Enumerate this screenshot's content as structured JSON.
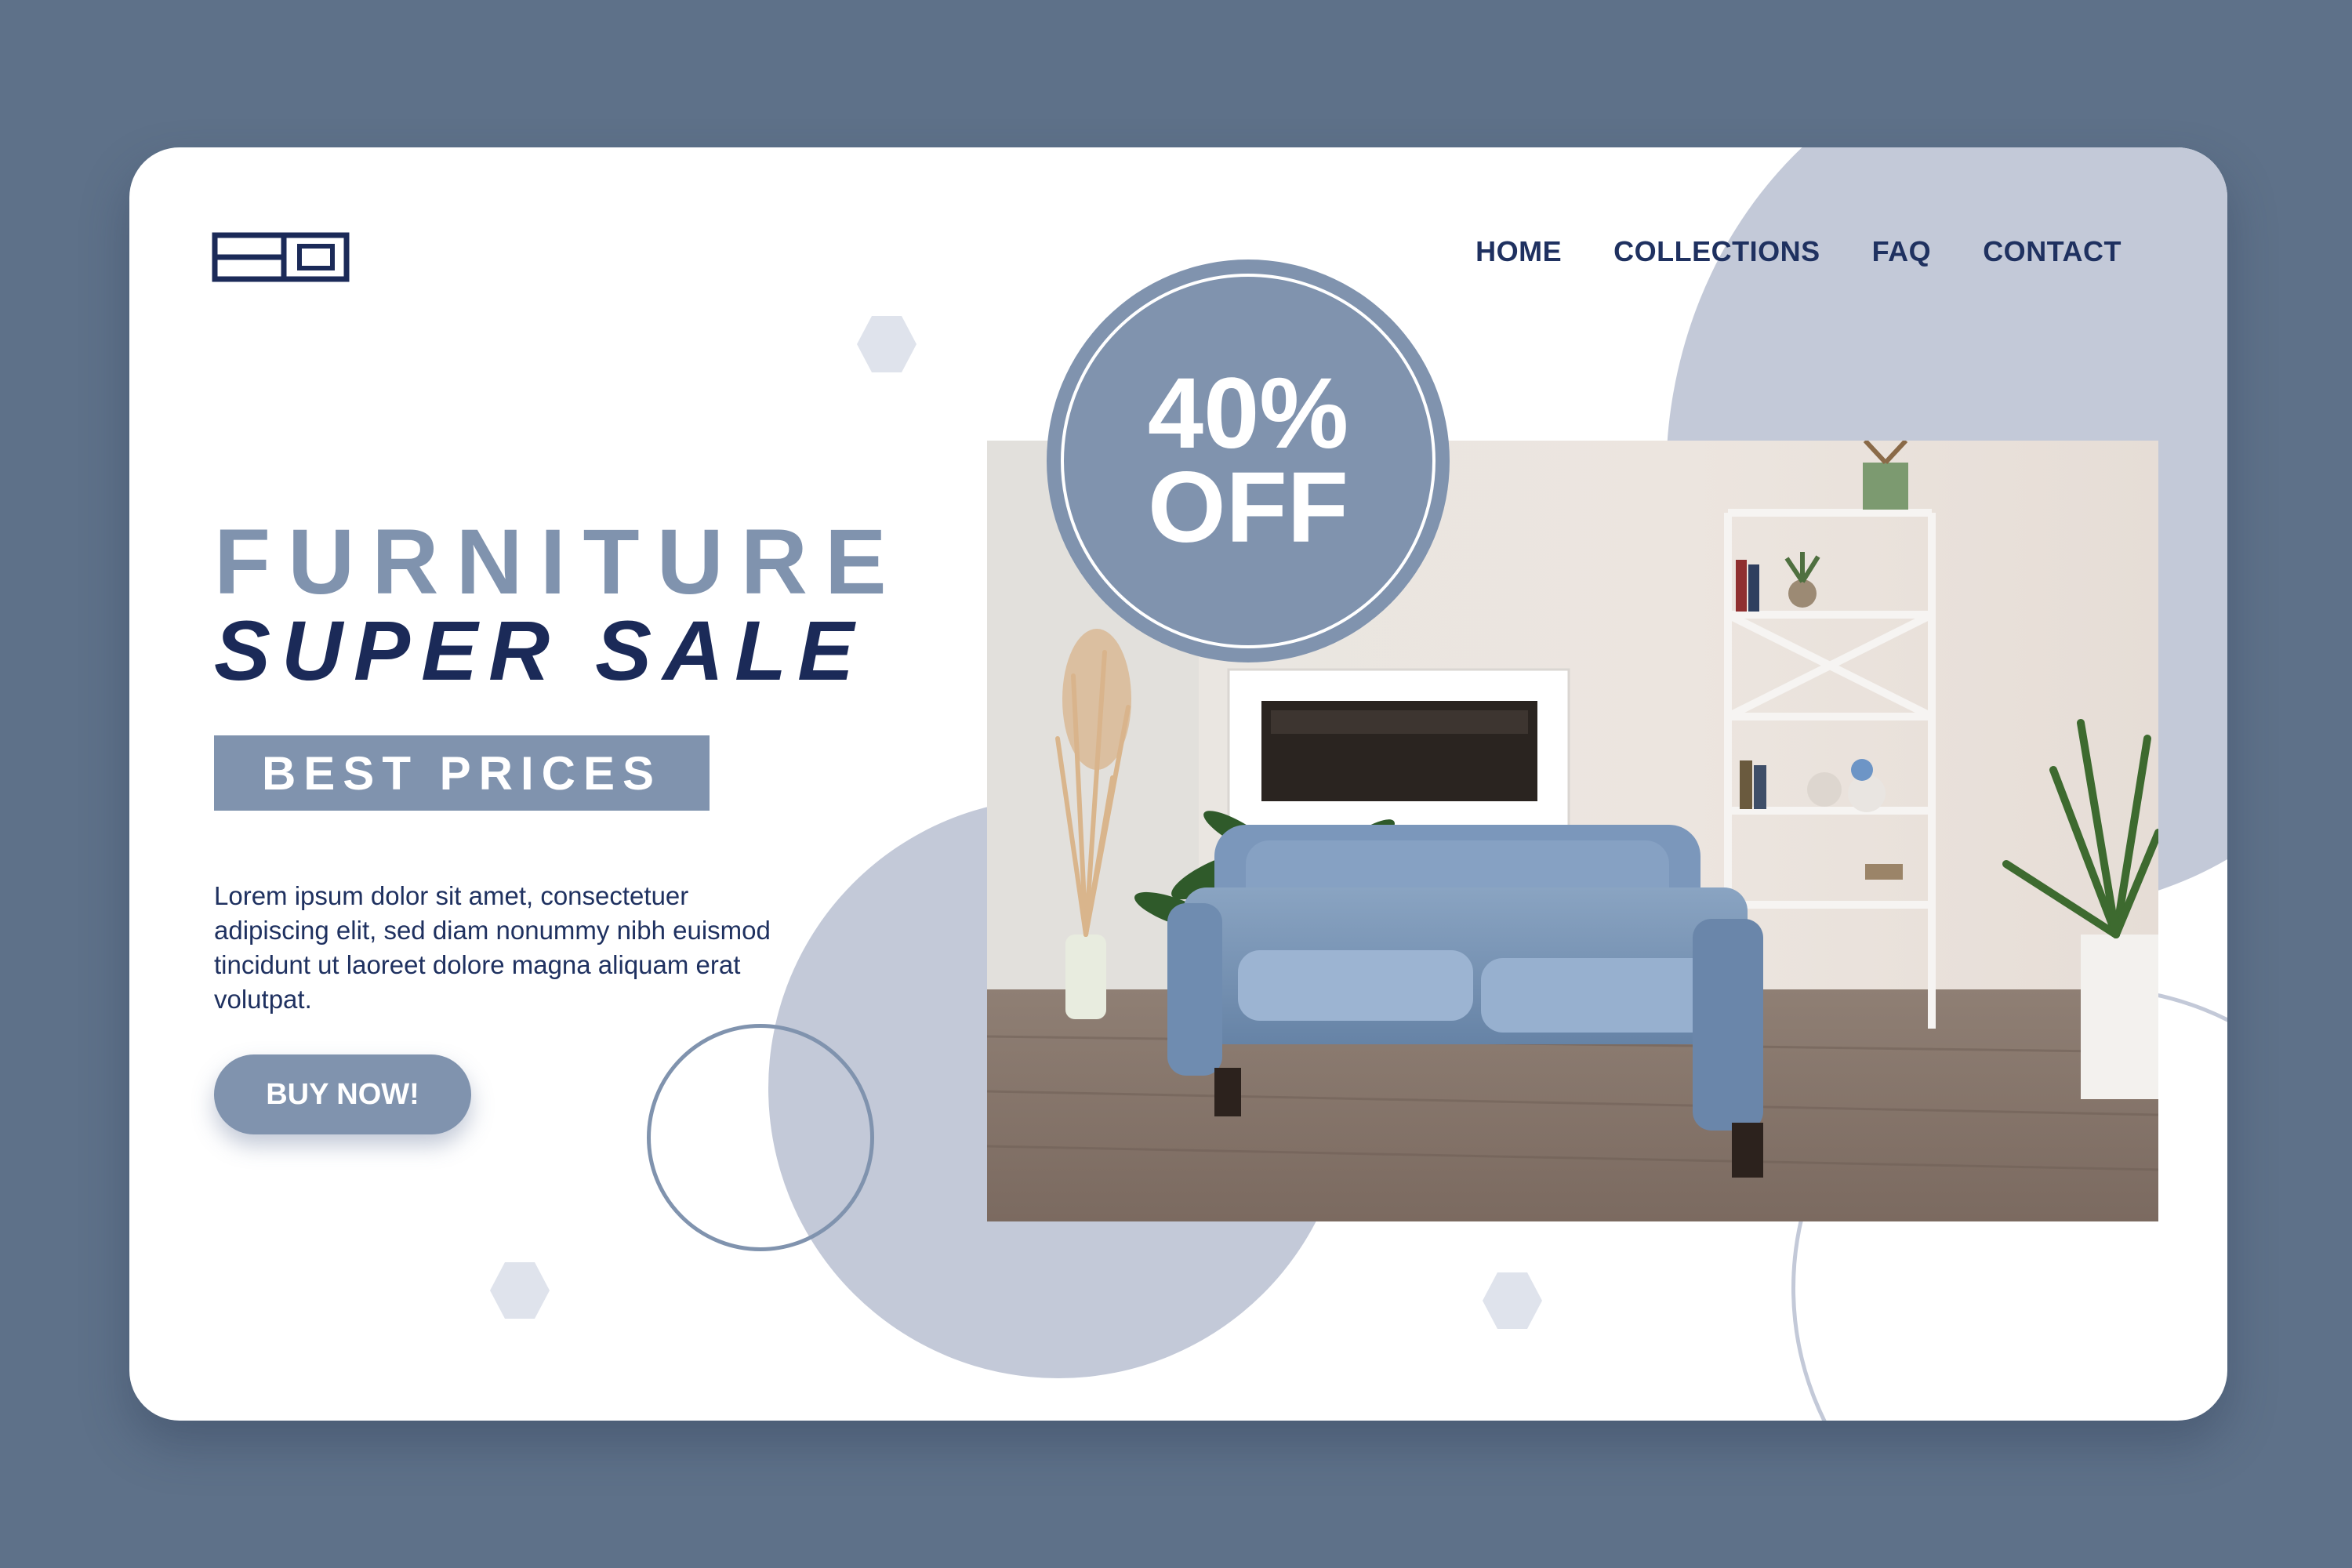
{
  "brand": {
    "logo_icon": "logo-mark"
  },
  "nav": {
    "items": [
      {
        "label": "HOME"
      },
      {
        "label": "COLLECTIONS"
      },
      {
        "label": "FAQ"
      },
      {
        "label": "CONTACT"
      }
    ]
  },
  "hero": {
    "title_line1": "FURNITURE",
    "title_line2": "SUPER SALE",
    "badge": "BEST PRICES",
    "description": "Lorem ipsum dolor sit amet, consectetuer adipiscing elit, sed diam nonummy nibh euismod tincidunt ut laoreet dolore magna aliquam erat volutpat.",
    "cta_label": "BUY NOW!"
  },
  "promo": {
    "percent": "40%",
    "off": "OFF"
  },
  "colors": {
    "page_bg": "#5e7189",
    "accent": "#8093ae",
    "navy": "#1b2a58",
    "light_blob": "#c3c9d8"
  }
}
